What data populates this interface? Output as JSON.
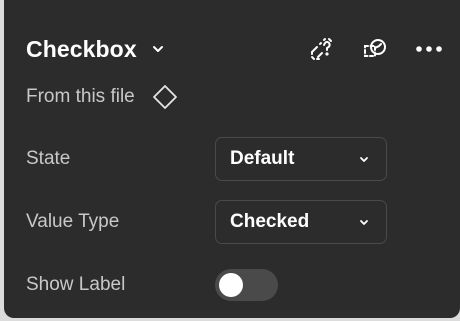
{
  "component": {
    "title": "Checkbox",
    "source": "From this file"
  },
  "header": {
    "icons": [
      "detach-instance-icon",
      "go-to-main-component-icon",
      "more-options-icon"
    ]
  },
  "properties": [
    {
      "label": "State",
      "type": "dropdown",
      "value": "Default"
    },
    {
      "label": "Value Type",
      "type": "dropdown",
      "value": "Checked"
    },
    {
      "label": "Show Label",
      "type": "toggle",
      "value": false
    }
  ],
  "colors": {
    "panel_background": "#2c2c2c",
    "text_primary": "#ffffff",
    "text_secondary": "#c8c8c8",
    "control_border": "#4a4a4a",
    "toggle_off_track": "#4a4a4a"
  }
}
